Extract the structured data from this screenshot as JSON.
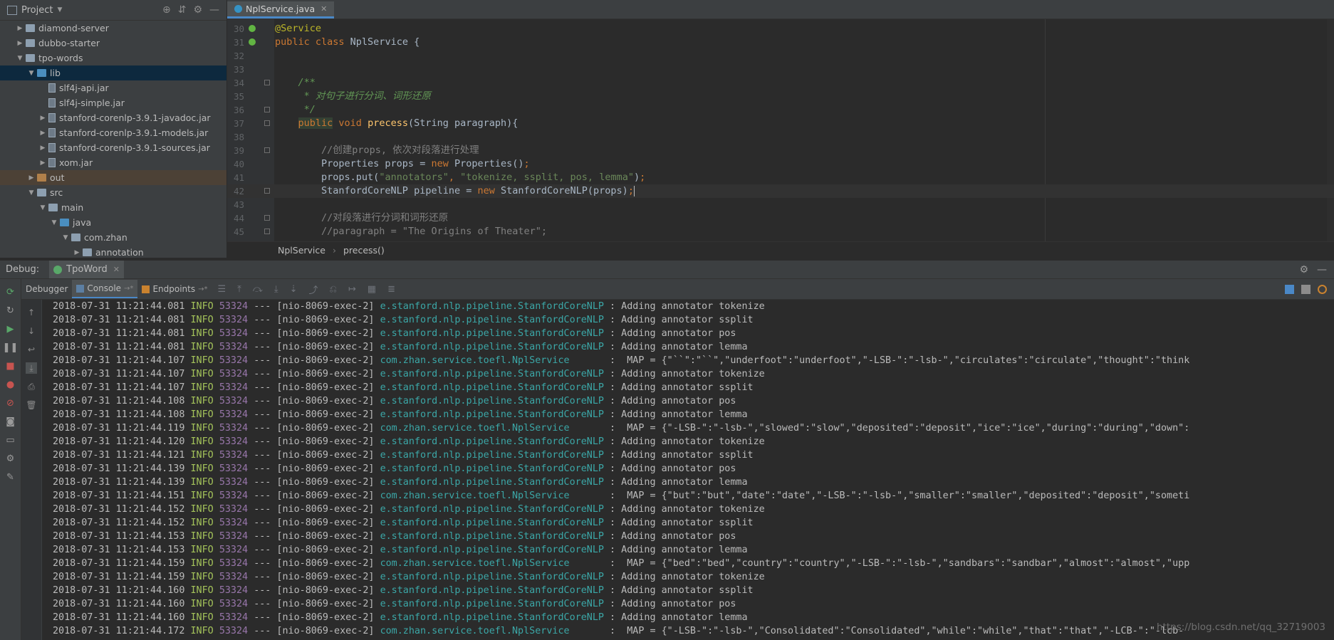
{
  "project": {
    "title": "Project",
    "tree": [
      {
        "label": "diamond-server",
        "kind": "folder",
        "state": "collapsed",
        "depth": 1
      },
      {
        "label": "dubbo-starter",
        "kind": "folder",
        "state": "collapsed",
        "depth": 1
      },
      {
        "label": "tpo-words",
        "kind": "folder",
        "state": "expanded",
        "depth": 1
      },
      {
        "label": "lib",
        "kind": "folder-blue",
        "state": "expanded",
        "depth": 2,
        "selected": true
      },
      {
        "label": "slf4j-api.jar",
        "kind": "jar",
        "state": "none",
        "depth": 3
      },
      {
        "label": "slf4j-simple.jar",
        "kind": "jar",
        "state": "none",
        "depth": 3
      },
      {
        "label": "stanford-corenlp-3.9.1-javadoc.jar",
        "kind": "jar",
        "state": "collapsed",
        "depth": 3
      },
      {
        "label": "stanford-corenlp-3.9.1-models.jar",
        "kind": "jar",
        "state": "collapsed",
        "depth": 3
      },
      {
        "label": "stanford-corenlp-3.9.1-sources.jar",
        "kind": "jar",
        "state": "collapsed",
        "depth": 3
      },
      {
        "label": "xom.jar",
        "kind": "jar",
        "state": "collapsed",
        "depth": 3
      },
      {
        "label": "out",
        "kind": "folder-orange",
        "state": "collapsed",
        "depth": 2,
        "excluded": true
      },
      {
        "label": "src",
        "kind": "folder",
        "state": "expanded",
        "depth": 2
      },
      {
        "label": "main",
        "kind": "folder",
        "state": "expanded",
        "depth": 3
      },
      {
        "label": "java",
        "kind": "folder-blue",
        "state": "expanded",
        "depth": 4
      },
      {
        "label": "com.zhan",
        "kind": "folder",
        "state": "expanded",
        "depth": 5
      },
      {
        "label": "annotation",
        "kind": "folder",
        "state": "collapsed",
        "depth": 6
      }
    ]
  },
  "editor": {
    "tab": "NplService.java",
    "lines": [
      {
        "n": "30",
        "html": "<span class='ann'>@Service</span>"
      },
      {
        "n": "31",
        "html": "<span class='kw'>public class </span>NplService {"
      },
      {
        "n": "32",
        "html": ""
      },
      {
        "n": "33",
        "html": ""
      },
      {
        "n": "34",
        "html": "    <span class='doc'>/**</span>"
      },
      {
        "n": "35",
        "html": "<span class='doc'>     * 对句子进行分词、词形还原</span>"
      },
      {
        "n": "36",
        "html": "<span class='doc'>     */</span>"
      },
      {
        "n": "37",
        "html": "    <span class='kw kwbox'>public</span><span class='kw'> void </span><span class='fn'>precess</span>(String paragraph){"
      },
      {
        "n": "38",
        "html": ""
      },
      {
        "n": "39",
        "html": "        <span class='cm'>//创建props, 依次对段落进行处理</span>"
      },
      {
        "n": "40",
        "html": "        Properties props = <span class='kw'>new </span>Properties()<span class='kw'>;</span>"
      },
      {
        "n": "41",
        "html": "        props.put(<span class='str'>\"annotators\"</span><span class='kw'>, </span><span class='str'>\"tokenize, ssplit, pos, lemma\"</span>)<span class='kw'>;</span>"
      },
      {
        "n": "42",
        "html": "        StanfordCoreNLP pipeline = <span class='kw'>new </span>StanfordCoreNLP(props)<span class='kw'>;</span><span class='caret'></span>"
      },
      {
        "n": "43",
        "html": ""
      },
      {
        "n": "44",
        "html": "        <span class='cm'>//对段落进行分词和词形还原</span>"
      },
      {
        "n": "45",
        "html": "        <span class='cm'>//paragraph = \"The Origins of Theater\";</span>"
      }
    ],
    "breadcrumbs": [
      "NplService",
      "precess()"
    ]
  },
  "debug": {
    "label": "Debug:",
    "session": "TpoWord",
    "tabs": [
      "Debugger",
      "Console",
      "Endpoints"
    ]
  },
  "log_lines": [
    {
      "ts": "2018-07-31 11:21:44.081",
      "lvl": "INFO",
      "pid": "53324",
      "th": "--- [nio-8069-exec-2]",
      "cls": "e.stanford.nlp.pipeline.StanfordCoreNLP",
      "msg": " : Adding annotator tokenize"
    },
    {
      "ts": "2018-07-31 11:21:44.081",
      "lvl": "INFO",
      "pid": "53324",
      "th": "--- [nio-8069-exec-2]",
      "cls": "e.stanford.nlp.pipeline.StanfordCoreNLP",
      "msg": " : Adding annotator ssplit"
    },
    {
      "ts": "2018-07-31 11:21:44.081",
      "lvl": "INFO",
      "pid": "53324",
      "th": "--- [nio-8069-exec-2]",
      "cls": "e.stanford.nlp.pipeline.StanfordCoreNLP",
      "msg": " : Adding annotator pos"
    },
    {
      "ts": "2018-07-31 11:21:44.081",
      "lvl": "INFO",
      "pid": "53324",
      "th": "--- [nio-8069-exec-2]",
      "cls": "e.stanford.nlp.pipeline.StanfordCoreNLP",
      "msg": " : Adding annotator lemma"
    },
    {
      "ts": "2018-07-31 11:21:44.107",
      "lvl": "INFO",
      "pid": "53324",
      "th": "--- [nio-8069-exec-2]",
      "cls": "com.zhan.service.toefl.NplService      ",
      "msg": " :  MAP = {\"``\":\"``\",\"underfoot\":\"underfoot\",\"-LSB-\":\"-lsb-\",\"circulates\":\"circulate\",\"thought\":\"think"
    },
    {
      "ts": "2018-07-31 11:21:44.107",
      "lvl": "INFO",
      "pid": "53324",
      "th": "--- [nio-8069-exec-2]",
      "cls": "e.stanford.nlp.pipeline.StanfordCoreNLP",
      "msg": " : Adding annotator tokenize"
    },
    {
      "ts": "2018-07-31 11:21:44.107",
      "lvl": "INFO",
      "pid": "53324",
      "th": "--- [nio-8069-exec-2]",
      "cls": "e.stanford.nlp.pipeline.StanfordCoreNLP",
      "msg": " : Adding annotator ssplit"
    },
    {
      "ts": "2018-07-31 11:21:44.108",
      "lvl": "INFO",
      "pid": "53324",
      "th": "--- [nio-8069-exec-2]",
      "cls": "e.stanford.nlp.pipeline.StanfordCoreNLP",
      "msg": " : Adding annotator pos"
    },
    {
      "ts": "2018-07-31 11:21:44.108",
      "lvl": "INFO",
      "pid": "53324",
      "th": "--- [nio-8069-exec-2]",
      "cls": "e.stanford.nlp.pipeline.StanfordCoreNLP",
      "msg": " : Adding annotator lemma"
    },
    {
      "ts": "2018-07-31 11:21:44.119",
      "lvl": "INFO",
      "pid": "53324",
      "th": "--- [nio-8069-exec-2]",
      "cls": "com.zhan.service.toefl.NplService      ",
      "msg": " :  MAP = {\"-LSB-\":\"-lsb-\",\"slowed\":\"slow\",\"deposited\":\"deposit\",\"ice\":\"ice\",\"during\":\"during\",\"down\":"
    },
    {
      "ts": "2018-07-31 11:21:44.120",
      "lvl": "INFO",
      "pid": "53324",
      "th": "--- [nio-8069-exec-2]",
      "cls": "e.stanford.nlp.pipeline.StanfordCoreNLP",
      "msg": " : Adding annotator tokenize"
    },
    {
      "ts": "2018-07-31 11:21:44.121",
      "lvl": "INFO",
      "pid": "53324",
      "th": "--- [nio-8069-exec-2]",
      "cls": "e.stanford.nlp.pipeline.StanfordCoreNLP",
      "msg": " : Adding annotator ssplit"
    },
    {
      "ts": "2018-07-31 11:21:44.139",
      "lvl": "INFO",
      "pid": "53324",
      "th": "--- [nio-8069-exec-2]",
      "cls": "e.stanford.nlp.pipeline.StanfordCoreNLP",
      "msg": " : Adding annotator pos"
    },
    {
      "ts": "2018-07-31 11:21:44.139",
      "lvl": "INFO",
      "pid": "53324",
      "th": "--- [nio-8069-exec-2]",
      "cls": "e.stanford.nlp.pipeline.StanfordCoreNLP",
      "msg": " : Adding annotator lemma"
    },
    {
      "ts": "2018-07-31 11:21:44.151",
      "lvl": "INFO",
      "pid": "53324",
      "th": "--- [nio-8069-exec-2]",
      "cls": "com.zhan.service.toefl.NplService      ",
      "msg": " :  MAP = {\"but\":\"but\",\"date\":\"date\",\"-LSB-\":\"-lsb-\",\"smaller\":\"smaller\",\"deposited\":\"deposit\",\"someti"
    },
    {
      "ts": "2018-07-31 11:21:44.152",
      "lvl": "INFO",
      "pid": "53324",
      "th": "--- [nio-8069-exec-2]",
      "cls": "e.stanford.nlp.pipeline.StanfordCoreNLP",
      "msg": " : Adding annotator tokenize"
    },
    {
      "ts": "2018-07-31 11:21:44.152",
      "lvl": "INFO",
      "pid": "53324",
      "th": "--- [nio-8069-exec-2]",
      "cls": "e.stanford.nlp.pipeline.StanfordCoreNLP",
      "msg": " : Adding annotator ssplit"
    },
    {
      "ts": "2018-07-31 11:21:44.153",
      "lvl": "INFO",
      "pid": "53324",
      "th": "--- [nio-8069-exec-2]",
      "cls": "e.stanford.nlp.pipeline.StanfordCoreNLP",
      "msg": " : Adding annotator pos"
    },
    {
      "ts": "2018-07-31 11:21:44.153",
      "lvl": "INFO",
      "pid": "53324",
      "th": "--- [nio-8069-exec-2]",
      "cls": "e.stanford.nlp.pipeline.StanfordCoreNLP",
      "msg": " : Adding annotator lemma"
    },
    {
      "ts": "2018-07-31 11:21:44.159",
      "lvl": "INFO",
      "pid": "53324",
      "th": "--- [nio-8069-exec-2]",
      "cls": "com.zhan.service.toefl.NplService      ",
      "msg": " :  MAP = {\"bed\":\"bed\",\"country\":\"country\",\"-LSB-\":\"-lsb-\",\"sandbars\":\"sandbar\",\"almost\":\"almost\",\"upp"
    },
    {
      "ts": "2018-07-31 11:21:44.159",
      "lvl": "INFO",
      "pid": "53324",
      "th": "--- [nio-8069-exec-2]",
      "cls": "e.stanford.nlp.pipeline.StanfordCoreNLP",
      "msg": " : Adding annotator tokenize"
    },
    {
      "ts": "2018-07-31 11:21:44.160",
      "lvl": "INFO",
      "pid": "53324",
      "th": "--- [nio-8069-exec-2]",
      "cls": "e.stanford.nlp.pipeline.StanfordCoreNLP",
      "msg": " : Adding annotator ssplit"
    },
    {
      "ts": "2018-07-31 11:21:44.160",
      "lvl": "INFO",
      "pid": "53324",
      "th": "--- [nio-8069-exec-2]",
      "cls": "e.stanford.nlp.pipeline.StanfordCoreNLP",
      "msg": " : Adding annotator pos"
    },
    {
      "ts": "2018-07-31 11:21:44.160",
      "lvl": "INFO",
      "pid": "53324",
      "th": "--- [nio-8069-exec-2]",
      "cls": "e.stanford.nlp.pipeline.StanfordCoreNLP",
      "msg": " : Adding annotator lemma"
    },
    {
      "ts": "2018-07-31 11:21:44.172",
      "lvl": "INFO",
      "pid": "53324",
      "th": "--- [nio-8069-exec-2]",
      "cls": "com.zhan.service.toefl.NplService      ",
      "msg": " :  MAP = {\"-LSB-\":\"-lsb-\",\"Consolidated\":\"Consolidated\",\"while\":\"while\",\"that\":\"that\",\"-LCB-\":\"-lcb-"
    }
  ],
  "watermark": "https://blog.csdn.net/qq_32719003"
}
